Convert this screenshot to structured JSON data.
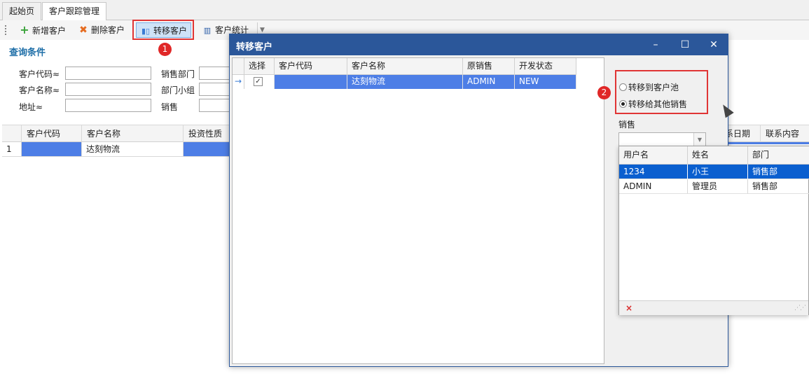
{
  "tabs": [
    {
      "label": "起始页"
    },
    {
      "label": "客户跟踪管理"
    }
  ],
  "toolbar": {
    "add_label": "新增客户",
    "delete_label": "删除客户",
    "transfer_label": "转移客户",
    "stats_label": "客户统计"
  },
  "annotations": {
    "badge1": "1",
    "badge2": "2",
    "annotation_color": "#e03535"
  },
  "query": {
    "title": "查询条件",
    "customer_code_label": "客户代码≈",
    "customer_name_label": "客户名称≈",
    "address_label": "地址≈",
    "sales_dept_label": "销售部门",
    "dept_group_label": "部门小组",
    "sales_label": "销售"
  },
  "main_grid": {
    "columns": [
      "客户代码",
      "客户名称",
      "投资性质",
      "联系日期",
      "联系内容"
    ],
    "date_col_visible": "系日期",
    "rows": [
      {
        "index": "1",
        "code": "",
        "name": "达刻物流",
        "invest": ""
      }
    ]
  },
  "dialog": {
    "title": "转移客户",
    "minimize": "–",
    "maximize": "☐",
    "close": "✕",
    "title_bar_color": "#2b579a",
    "grid": {
      "columns": [
        "选择",
        "客户代码",
        "客户名称",
        "原销售",
        "开发状态"
      ],
      "rows": [
        {
          "selected": "✓",
          "code": "",
          "name": "达刻物流",
          "original_sales": "ADMIN",
          "status": "NEW"
        }
      ]
    },
    "options": {
      "to_pool": "转移到客户池",
      "to_other_sales": "转移给其他销售",
      "selected": "to_other_sales"
    },
    "sales_label": "销售",
    "sales_value": ""
  },
  "sales_popup": {
    "columns": [
      "用户名",
      "姓名",
      "部门"
    ],
    "rows": [
      {
        "username": "1234",
        "name": "小王",
        "dept": "销售部"
      },
      {
        "username": "ADMIN",
        "name": "管理员",
        "dept": "销售部"
      }
    ],
    "selected_index": 0,
    "delete_icon": "×"
  }
}
